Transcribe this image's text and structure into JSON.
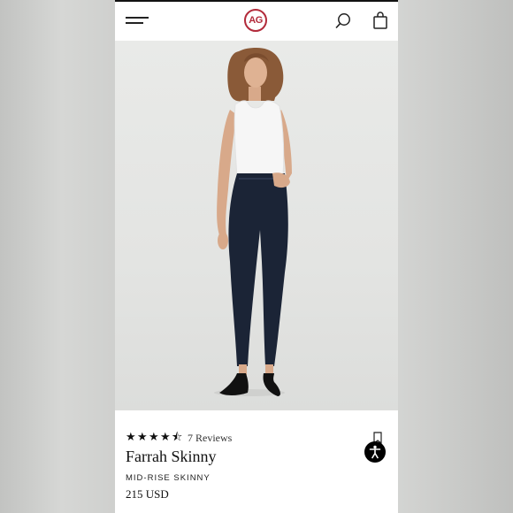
{
  "header": {
    "logo_text": "AG",
    "icons": [
      "menu-icon",
      "search-icon",
      "bag-icon"
    ]
  },
  "product": {
    "rating": 4.5,
    "rating_max": 5,
    "reviews_label": "7 Reviews",
    "name": "Farrah Skinny",
    "fit": "MID-RISE SKINNY",
    "price": "215 USD"
  },
  "colors": {
    "brand": "#b22a3a",
    "denim": "#1b2436",
    "text": "#111111"
  }
}
